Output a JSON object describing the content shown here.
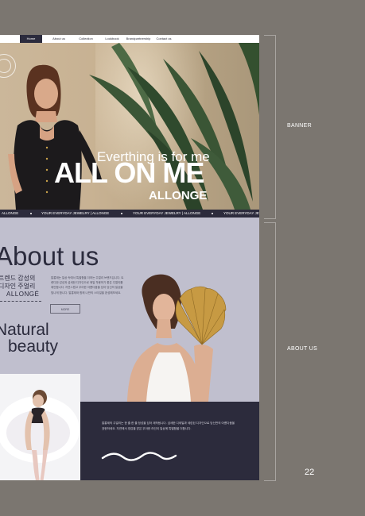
{
  "nav": {
    "items": [
      "Home",
      "About us",
      "Collection",
      "Lookbook",
      "Brandpartnership",
      "Contact us"
    ],
    "active_index": 0
  },
  "banner": {
    "tagline": "Everthing is for me",
    "headline": "ALL ON ME",
    "brand": "ALLONGE"
  },
  "ticker": {
    "items": [
      "ALLONGE",
      "YOUR EVERYDAY JEWELRY | ALLONGE",
      "YOUR EVERYDAY JEWELRY | ALLONGE",
      "YOUR EVERYDAY JEWELRY | ALLONGE"
    ]
  },
  "about": {
    "title": "About us",
    "kr_line1": "트렌드 감성의",
    "kr_line2": "디자인 주얼리",
    "kr_brand": "ALLONGÉ",
    "paragraph": "알롱제는 일상 속에서 특별함을 더하는 주얼리 브랜드입니다. 트렌디한 감성과 섬세한 디자인으로 매일 착용하기 좋은 주얼리를 제안합니다. 자연스럽고 우아한 아름다움을 담아 당신의 일상을 빛나게 합니다. 알롱제와 함께 나만의 스타일을 완성해보세요.",
    "more_button": "MORE",
    "natural": "Natural",
    "beauty": "beauty"
  },
  "band": {
    "text": "알롱제의 주얼리는 한 줄 한 줄 정성을 담아 제작됩니다. 섬세한 디테일과 세련된 디자인으로 당신만의 아름다움을 표현하세요. 자연에서 영감을 받은 우아한 라인이 일상에 특별함을 더합니다."
  },
  "annotations": {
    "banner_label": "BANNER",
    "about_label": "ABOUT US",
    "page_number": "22"
  },
  "colors": {
    "background": "#7b7670",
    "navy": "#2c2b3c",
    "lavender": "#c0bfce",
    "white": "#ffffff"
  }
}
